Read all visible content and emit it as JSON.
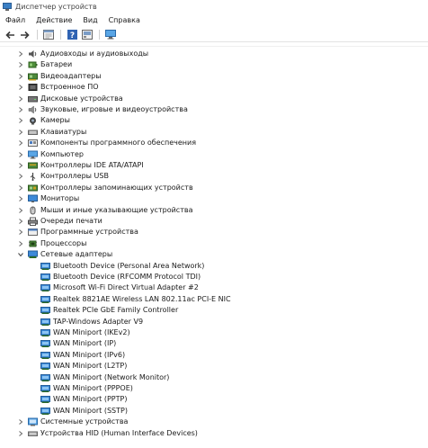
{
  "window": {
    "title": "Диспетчер устройств"
  },
  "menu": [
    "Файл",
    "Действие",
    "Вид",
    "Справка"
  ],
  "toolbar": {
    "buttons": [
      "back-arrow-icon",
      "forward-arrow-icon",
      "properties-icon",
      "help-icon",
      "update-driver-icon",
      "scan-hardware-icon"
    ]
  },
  "tree": {
    "categories_top": [
      {
        "label": "Аудиовходы и аудиовыходы",
        "icon": "speaker-icon"
      },
      {
        "label": "Батареи",
        "icon": "battery-icon"
      },
      {
        "label": "Видеоадаптеры",
        "icon": "display-adapter-icon"
      },
      {
        "label": "Встроенное ПО",
        "icon": "firmware-icon"
      },
      {
        "label": "Дисковые устройства",
        "icon": "disk-drive-icon"
      },
      {
        "label": "Звуковые, игровые и видеоустройства",
        "icon": "sound-icon"
      },
      {
        "label": "Камеры",
        "icon": "camera-icon"
      },
      {
        "label": "Клавиатуры",
        "icon": "keyboard-icon"
      },
      {
        "label": "Компоненты программного обеспечения",
        "icon": "software-component-icon"
      },
      {
        "label": "Компьютер",
        "icon": "computer-icon"
      },
      {
        "label": "Контроллеры IDE ATA/ATAPI",
        "icon": "ide-controller-icon"
      },
      {
        "label": "Контроллеры USB",
        "icon": "usb-icon"
      },
      {
        "label": "Контроллеры запоминающих устройств",
        "icon": "storage-controller-icon"
      },
      {
        "label": "Мониторы",
        "icon": "monitor-icon"
      },
      {
        "label": "Мыши и иные указывающие устройства",
        "icon": "mouse-icon"
      },
      {
        "label": "Очереди печати",
        "icon": "printer-icon"
      },
      {
        "label": "Программные устройства",
        "icon": "software-device-icon"
      },
      {
        "label": "Процессоры",
        "icon": "processor-icon"
      }
    ],
    "network": {
      "label": "Сетевые адаптеры",
      "icon": "network-adapter-icon",
      "children": [
        "Bluetooth Device (Personal Area Network)",
        "Bluetooth Device (RFCOMM Protocol TDI)",
        "Microsoft Wi-Fi Direct Virtual Adapter #2",
        "Realtek 8821AE Wireless LAN 802.11ac PCI-E NIC",
        "Realtek PCIe GbE Family Controller",
        "TAP-Windows Adapter V9",
        "WAN Miniport (IKEv2)",
        "WAN Miniport (IP)",
        "WAN Miniport (IPv6)",
        "WAN Miniport (L2TP)",
        "WAN Miniport (Network Monitor)",
        "WAN Miniport (PPPOE)",
        "WAN Miniport (PPTP)",
        "WAN Miniport (SSTP)"
      ]
    },
    "categories_bottom": [
      {
        "label": "Системные устройства",
        "icon": "system-device-icon"
      },
      {
        "label": "Устройства HID (Human Interface Devices)",
        "icon": "hid-icon"
      }
    ]
  }
}
